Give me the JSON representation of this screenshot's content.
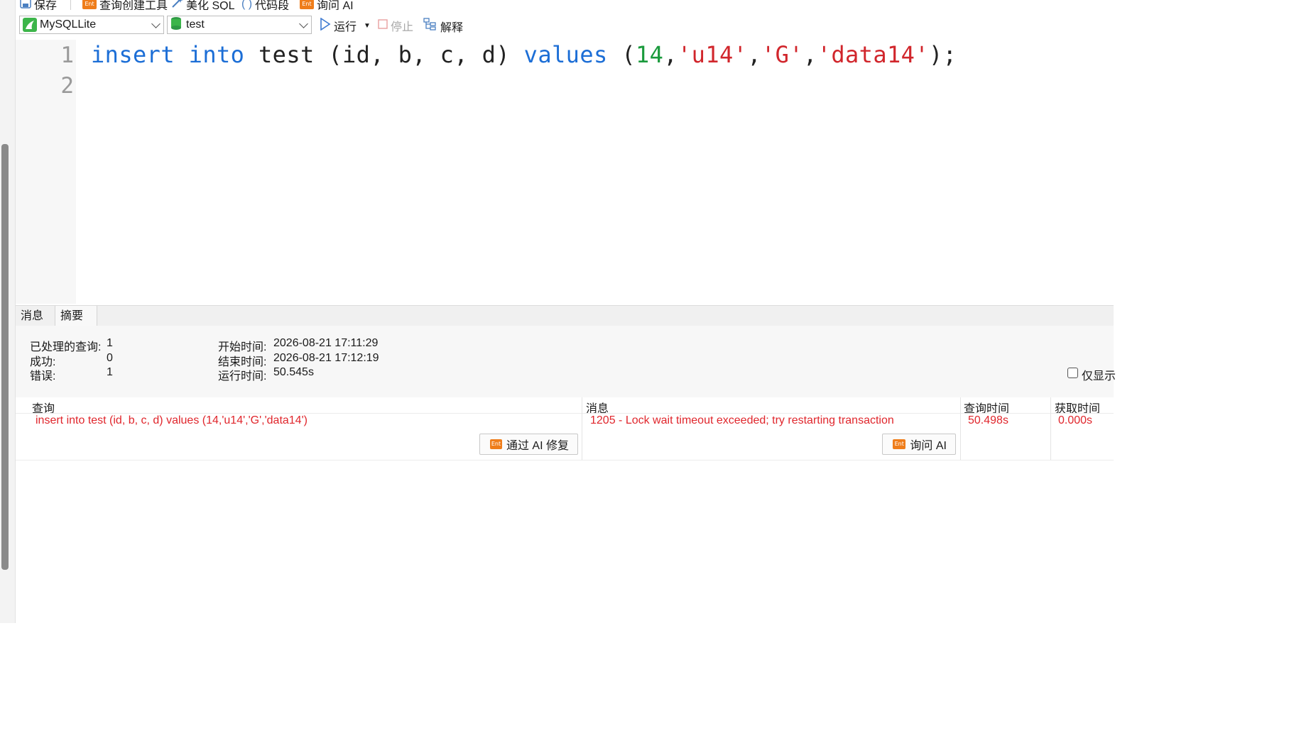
{
  "toolbar_top": {
    "save_label": "保存",
    "query_builder_label": "查询创建工具",
    "beautify_label": "美化 SQL",
    "snippet_label": "代码段",
    "ask_ai_label": "询问 AI",
    "ent_badge": "Ent"
  },
  "toolbar": {
    "connection": "MySQLLite",
    "database": "test",
    "run_label": "运行",
    "stop_label": "停止",
    "explain_label": "解释"
  },
  "editor": {
    "line_numbers": [
      "1",
      "2"
    ],
    "code_tokens": {
      "t1": "insert",
      "t2": " ",
      "t3": "into",
      "t4": " test (id, b, c, d) ",
      "t5": "values",
      "t6": " (",
      "t7": "14",
      "t8": ",",
      "t9": "'u14'",
      "t10": ",",
      "t11": "'G'",
      "t12": ",",
      "t13": "'data14'",
      "t14": ");"
    }
  },
  "tabs": {
    "message": "消息",
    "summary": "摘要"
  },
  "summary": {
    "processed_label": "已处理的查询:",
    "processed_value": "1",
    "success_label": "成功:",
    "success_value": "0",
    "error_label": "错误:",
    "error_value": "1",
    "start_label": "开始时间:",
    "start_value": "2026-08-21 17:11:29",
    "end_label": "结束时间:",
    "end_value": "2026-08-21 17:12:19",
    "runtime_label": "运行时间:",
    "runtime_value": "50.545s",
    "only_show_label": "仅显示"
  },
  "results": {
    "columns": {
      "query": "查询",
      "message": "消息",
      "query_time": "查询时间",
      "fetch_time": "获取时间"
    },
    "row": {
      "query": "insert into test (id, b, c, d) values (14,'u14','G','data14')",
      "message": "1205 - Lock wait timeout exceeded; try restarting transaction",
      "query_time": "50.498s",
      "fetch_time": "0.000s"
    },
    "fix_button_label": "通过 AI 修复",
    "ask_ai_button_label": "询问 AI"
  },
  "colors": {
    "keyword": "#1c6ed6",
    "number": "#1a9a3c",
    "string": "#d1262c",
    "error_text": "#e0262c",
    "ent_badge": "#ef7d1a"
  }
}
